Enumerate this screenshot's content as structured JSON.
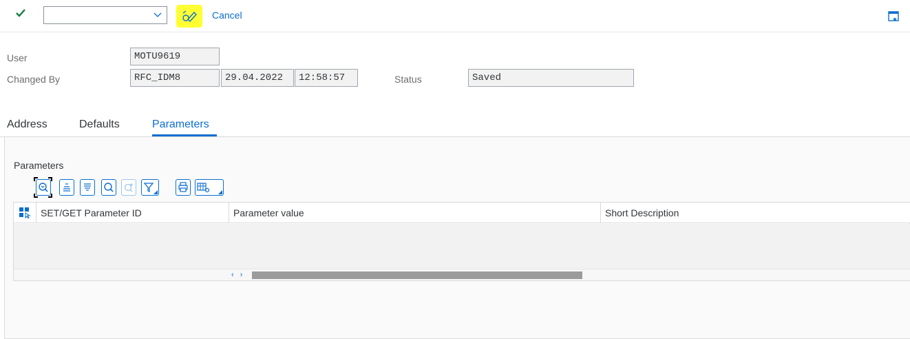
{
  "toolbar": {
    "check_icon": "checkmark-icon",
    "command_field_value": "",
    "edit_icon": "edit-pencil-icon",
    "cancel_label": "Cancel",
    "window_icon": "window-icon",
    "highlight_color": "#ffff33"
  },
  "header": {
    "user_label": "User",
    "user_value": "MOTU9619",
    "changed_by_label": "Changed By",
    "changed_by_value": "RFC_IDM8",
    "changed_date": "29.04.2022",
    "changed_time": "12:58:57",
    "status_label": "Status",
    "status_value": "Saved"
  },
  "tabs": [
    {
      "label": "Address",
      "active": false
    },
    {
      "label": "Defaults",
      "active": false
    },
    {
      "label": "Parameters",
      "active": true
    }
  ],
  "parameters": {
    "section_title": "Parameters",
    "toolbar_buttons": [
      "details-icon",
      "sort-ascending-icon",
      "sort-descending-icon",
      "find-icon",
      "find-next-icon",
      "filter-icon",
      "print-icon",
      "layout-icon"
    ],
    "table": {
      "columns": [
        "SET/GET Parameter ID",
        "Parameter value",
        "Short Description"
      ],
      "rows": []
    }
  },
  "colors": {
    "accent": "#0a6ed1",
    "check": "#107e3e"
  }
}
